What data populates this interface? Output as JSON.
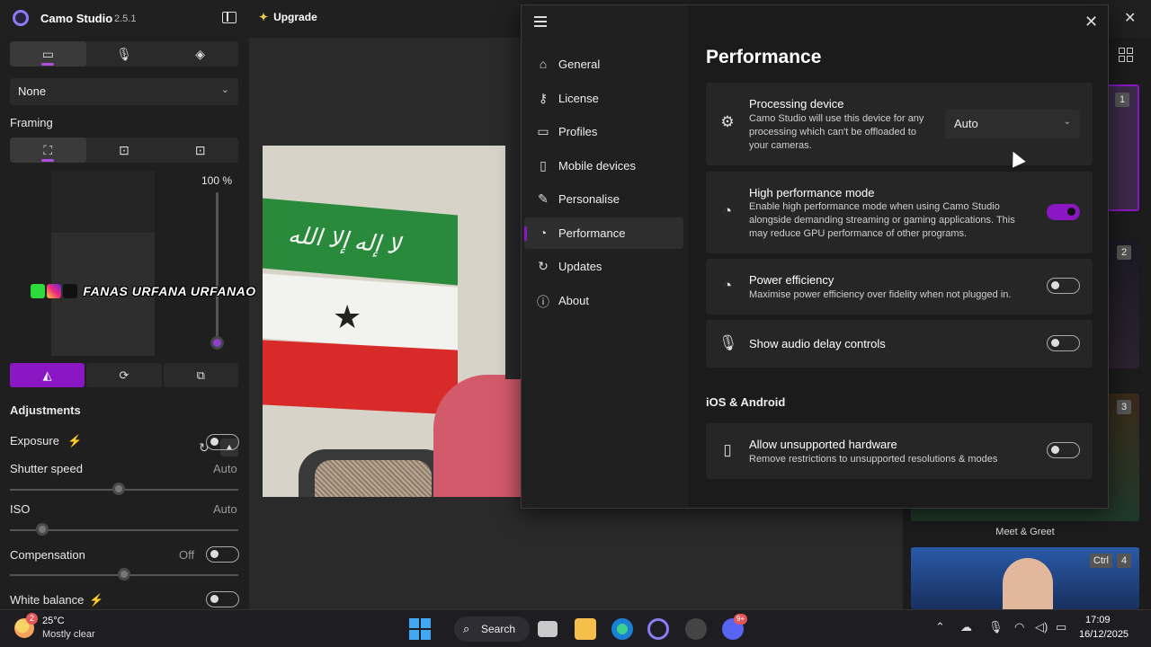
{
  "app": {
    "name": "Camo Studio",
    "version": "2.5.1",
    "upgrade_label": "Upgrade"
  },
  "left": {
    "source_select": "None",
    "framing_label": "Framing",
    "zoom_value": "100 %",
    "adjustments_label": "Adjustments",
    "exposure_label": "Exposure",
    "shutter_label": "Shutter speed",
    "shutter_value": "Auto",
    "iso_label": "ISO",
    "iso_value": "Auto",
    "compensation_label": "Compensation",
    "compensation_value": "Off",
    "white_balance_label": "White balance"
  },
  "watermark": {
    "text": "FANAS  URFANA  URFANAO"
  },
  "settings": {
    "nav": [
      {
        "label": "General",
        "icon": "home-icon"
      },
      {
        "label": "License",
        "icon": "key-icon"
      },
      {
        "label": "Profiles",
        "icon": "monitor-icon"
      },
      {
        "label": "Mobile devices",
        "icon": "phone-icon"
      },
      {
        "label": "Personalise",
        "icon": "brush-icon"
      },
      {
        "label": "Performance",
        "icon": "gauge-icon"
      },
      {
        "label": "Updates",
        "icon": "refresh-icon"
      },
      {
        "label": "About",
        "icon": "info-icon"
      }
    ],
    "active_nav": "Performance",
    "title": "Performance",
    "processing": {
      "title": "Processing device",
      "desc": "Camo Studio will use this device for any processing which can't be offloaded to your cameras.",
      "value": "Auto"
    },
    "high_perf": {
      "title": "High performance mode",
      "desc": "Enable high performance mode when using Camo Studio alongside demanding streaming or gaming applications. This may reduce GPU performance of other programs.",
      "on": true
    },
    "power": {
      "title": "Power efficiency",
      "desc": "Maximise power efficiency over fidelity when not plugged in.",
      "on": false
    },
    "audio_delay": {
      "title": "Show audio delay controls",
      "on": false
    },
    "section_ios": "iOS & Android",
    "unsupported": {
      "title": "Allow unsupported hardware",
      "desc": "Remove restrictions to unsupported resolutions & modes",
      "on": false
    }
  },
  "thumbnails": {
    "t1": "1",
    "t2": "2",
    "t3": "3",
    "t4": "4",
    "ctrl": "Ctrl",
    "caption3": "Meet & Greet"
  },
  "taskbar": {
    "temp": "25°C",
    "condition": "Mostly clear",
    "weather_badge": "2",
    "search": "Search",
    "discord_badge": "9+",
    "time": "17:09",
    "date": "16/12/2025"
  },
  "flag_text": "لا إله إلا الله"
}
